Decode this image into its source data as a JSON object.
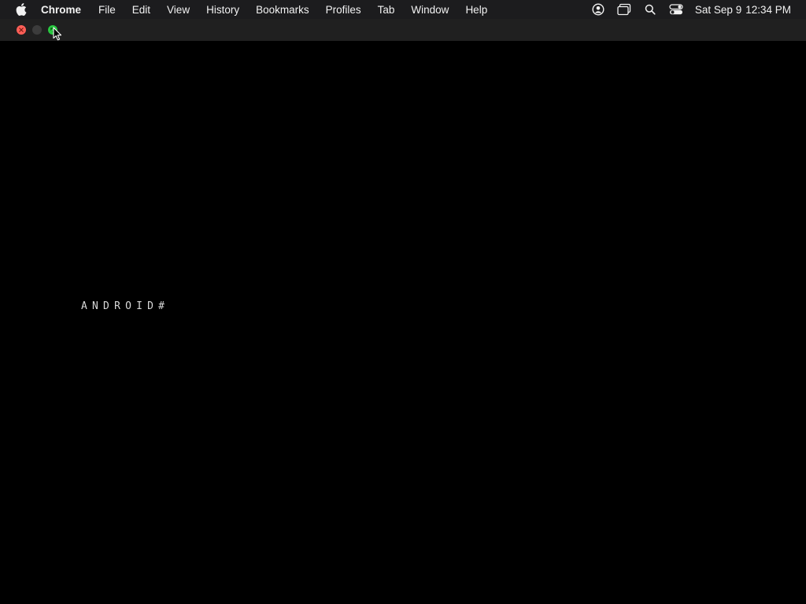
{
  "menubar": {
    "apple_icon": "apple-logo-icon",
    "app_name": "Chrome",
    "items": [
      {
        "label": "File"
      },
      {
        "label": "Edit"
      },
      {
        "label": "View"
      },
      {
        "label": "History"
      },
      {
        "label": "Bookmarks"
      },
      {
        "label": "Profiles"
      },
      {
        "label": "Tab"
      },
      {
        "label": "Window"
      },
      {
        "label": "Help"
      }
    ],
    "status_icons": [
      "user-account-icon",
      "screen-mirroring-icon",
      "spotlight-search-icon",
      "control-center-icon"
    ],
    "clock": {
      "date": "Sat Sep 9",
      "time": "12:34 PM"
    }
  },
  "window": {
    "traffic_lights": {
      "close_color": "#ff5f57",
      "minimize_color": "#3c3c3c",
      "maximize_color": "#28c840"
    }
  },
  "terminal": {
    "prompt": "ANDROID#"
  }
}
